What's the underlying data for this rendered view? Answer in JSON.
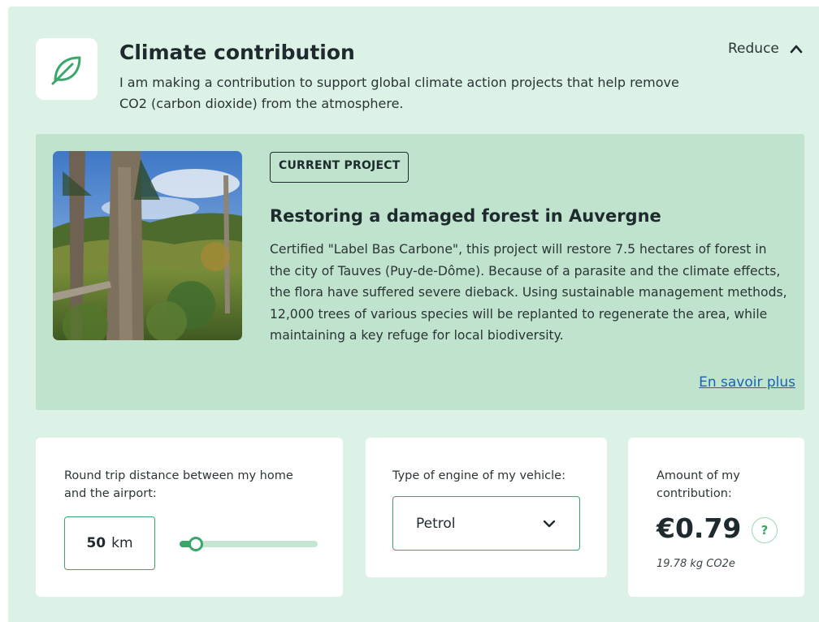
{
  "header": {
    "title": "Climate contribution",
    "subtitle": "I am making a contribution to support global climate action projects that help remove CO2 (carbon dioxide) from the atmosphere.",
    "toggle_label": "Reduce"
  },
  "project": {
    "badge": "CURRENT PROJECT",
    "title": "Restoring a damaged forest in Auvergne",
    "description": "Certified \"Label Bas Carbone\", this project will restore 7.5 hectares of forest in the city of Tauves (Puy-de-Dôme). Because of a parasite and the climate effects, the flora have suffered severe dieback. Using sustainable management methods, 12,000 trees of various species will be replanted to regenerate the area, while maintaining a key refuge for local biodiversity.",
    "link_label": "En savoir plus"
  },
  "distance": {
    "label": "Round trip distance between my home and the airport:",
    "value": "50",
    "unit": "km",
    "slider_fraction": 0.12
  },
  "engine": {
    "label": "Type of engine of my vehicle:",
    "selected": "Petrol"
  },
  "amount": {
    "label": "Amount of my contribution:",
    "value": "€0.79",
    "help_symbol": "?",
    "co2": "19.78 kg CO2e"
  },
  "icons": {
    "leaf": "leaf-icon",
    "reduce": "chevron-up-icon",
    "select": "chevron-down-icon",
    "help": "question-icon"
  },
  "colors": {
    "panel_bg": "#dcf2e6",
    "project_bg": "#bfe3cd",
    "accent": "#3aa76a",
    "link": "#1b62b3"
  }
}
